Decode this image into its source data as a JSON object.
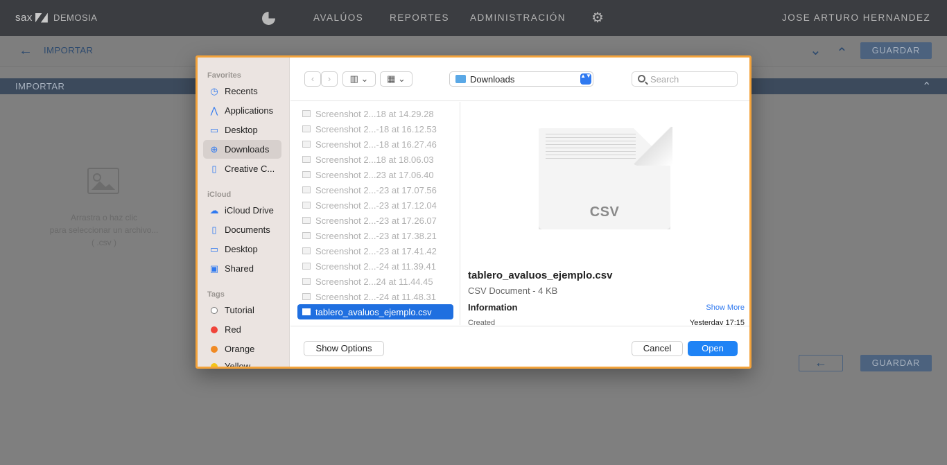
{
  "app": {
    "logo_text": "sax",
    "org_name": "DEMOSIA",
    "nav": [
      "AVALÚOS",
      "REPORTES",
      "ADMINISTRACIÓN"
    ],
    "user": "JOSE ARTURO HERNANDEZ"
  },
  "page": {
    "title": "IMPORTAR",
    "save_label": "GUARDAR",
    "section_title": "IMPORTAR",
    "drop_line1": "Arrastra o haz clic",
    "drop_line2": "para seleccionar un archivo...",
    "drop_line3": "( .csv )",
    "bottom_save_label": "GUARDAR",
    "back_arrow": "←",
    "up_chevron": "⌃",
    "down_chevron": "⌄"
  },
  "dialog": {
    "sidebar": {
      "favorites_title": "Favorites",
      "favorites": [
        {
          "label": "Recents",
          "icon": "clock-icon",
          "glyph": "◷"
        },
        {
          "label": "Applications",
          "icon": "applications-icon",
          "glyph": "⋀"
        },
        {
          "label": "Desktop",
          "icon": "desktop-icon",
          "glyph": "▭"
        },
        {
          "label": "Downloads",
          "icon": "downloads-icon",
          "glyph": "⊕"
        },
        {
          "label": "Creative C...",
          "icon": "document-icon",
          "glyph": "▯"
        }
      ],
      "icloud_title": "iCloud",
      "icloud": [
        {
          "label": "iCloud Drive",
          "icon": "cloud-icon",
          "glyph": "☁"
        },
        {
          "label": "Documents",
          "icon": "document-icon",
          "glyph": "▯"
        },
        {
          "label": "Desktop",
          "icon": "desktop-icon",
          "glyph": "▭"
        },
        {
          "label": "Shared",
          "icon": "shared-folder-icon",
          "glyph": "▣"
        }
      ],
      "tags_title": "Tags",
      "tags": [
        {
          "label": "Tutorial",
          "color": "#ffffff"
        },
        {
          "label": "Red",
          "color": "#f0443a"
        },
        {
          "label": "Orange",
          "color": "#f08a24"
        },
        {
          "label": "Yellow",
          "color": "#f5c518"
        }
      ]
    },
    "toolbar": {
      "back_glyph": "‹",
      "forward_glyph": "›",
      "view_glyph": "▥ ⌄",
      "group_glyph": "▦ ⌄",
      "location": "Downloads",
      "location_arrows": "▲▼",
      "search_placeholder": "Search"
    },
    "files": [
      "Screenshot 2...18 at 14.29.28",
      "Screenshot 2...-18 at 16.12.53",
      "Screenshot 2...-18 at 16.27.46",
      "Screenshot 2...18 at 18.06.03",
      "Screenshot 2...23 at 17.06.40",
      "Screenshot 2...-23 at 17.07.56",
      "Screenshot 2...-23 at 17.12.04",
      "Screenshot 2...-23 at 17.26.07",
      "Screenshot 2...-23 at 17.38.21",
      "Screenshot 2...-23 at 17.41.42",
      "Screenshot 2...-24 at 11.39.41",
      "Screenshot 2...24 at 11.44.45",
      "Screenshot 2...-24 at 11.48.31",
      "tablero_avaluos_ejemplo.csv"
    ],
    "selected_index": 13,
    "preview": {
      "ext": "CSV",
      "name": "tablero_avaluos_ejemplo.csv",
      "kind": "CSV Document - 4 KB",
      "info_title": "Information",
      "show_more": "Show More",
      "created_label": "Created",
      "created_value": "Yesterday 17:15"
    },
    "footer": {
      "show_options": "Show Options",
      "cancel": "Cancel",
      "open": "Open"
    },
    "accent": "#1f83f5",
    "focus_ring": "#f3a33b"
  }
}
